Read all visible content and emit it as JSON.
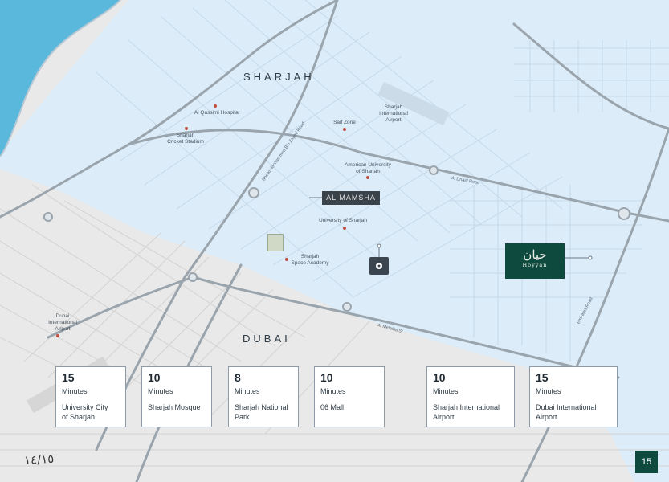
{
  "map": {
    "regions": {
      "sharjah": "SHARJAH",
      "dubai": "DUBAI"
    },
    "colors": {
      "sea": "#5ab8dc",
      "sharjah_area": "#dcecf8",
      "dubai_area": "#e9e9e9",
      "road": "#9aa4ad",
      "accent": "#0f4a3f"
    },
    "pois": {
      "al_qassimi": "Al Qassimi Hospital",
      "cricket": "Sharjah\nCricket Stadium",
      "saif_zone": "Saif Zone",
      "sharjah_airport": "Sharjah\nInternational\nAirport",
      "aus": "American University\nof Sharjah",
      "uos": "University of Sharjah",
      "space": "Sharjah\nSpace Academy",
      "dubai_airport": "Dubai\nInternational\nAirport"
    },
    "roads": {
      "emirates": "Emirates Road",
      "dhaid": "Al Dhaid Road",
      "melaiha": "Al Melaiha St.",
      "khalid": "Sheikh Mohammed Bin Zayed Road"
    },
    "almamsha_label": "AL MAMSHA",
    "hoyyan": {
      "arabic": "حيان",
      "latin": "Hoyyan"
    },
    "stamp": "١٤/١٥",
    "icons": {
      "destination": "location-pin-icon",
      "logo": "alqasba-logo-icon"
    }
  },
  "cards": [
    {
      "value": "15",
      "unit": "Minutes",
      "place": "University City\nof Sharjah"
    },
    {
      "value": "10",
      "unit": "Minutes",
      "place": "Sharjah Mosque"
    },
    {
      "value": "8",
      "unit": "Minutes",
      "place": "Sharjah National\nPark"
    },
    {
      "value": "10",
      "unit": "Minutes",
      "place": "06 Mall"
    },
    {
      "value": "10",
      "unit": "Minutes",
      "place": "Sharjah International\nAirport"
    },
    {
      "value": "15",
      "unit": "Minutes",
      "place": "Dubai International\nAirport"
    }
  ],
  "page_number": "15"
}
